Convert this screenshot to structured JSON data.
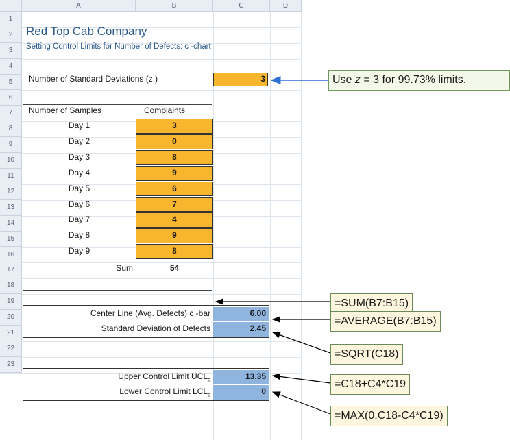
{
  "columns": [
    "A",
    "B",
    "C",
    "D"
  ],
  "rows": [
    "1",
    "2",
    "3",
    "4",
    "5",
    "6",
    "7",
    "8",
    "9",
    "10",
    "11",
    "12",
    "13",
    "14",
    "15",
    "16",
    "17",
    "18",
    "19",
    "20",
    "21",
    "22",
    "23"
  ],
  "title": "Red Top Cab Company",
  "subtitle": "Setting Control Limits for Number of Defects: c -chart",
  "std_dev_label": "Number of Standard Deviations (z )",
  "std_dev_value": "3",
  "table": {
    "header_samples": "Number of Samples",
    "header_complaints": "Complaints",
    "days": [
      "Day 1",
      "Day 2",
      "Day 3",
      "Day 4",
      "Day 5",
      "Day 6",
      "Day 7",
      "Day 8",
      "Day 9"
    ],
    "complaints": [
      "3",
      "0",
      "8",
      "9",
      "6",
      "7",
      "4",
      "9",
      "8"
    ],
    "sum_label": "Sum",
    "sum_value": "54"
  },
  "stats": {
    "center_label": "Center Line (Avg. Defects) c -bar",
    "center_value": "6.00",
    "sd_label": "Standard Deviation of Defects",
    "sd_value": "2.45",
    "ucl_label": "Upper Control Limit UCL",
    "ucl_sub": "c",
    "ucl_value": "13.35",
    "lcl_label": "Lower Control Limit LCL",
    "lcl_sub": "c",
    "lcl_value": "0"
  },
  "notes": {
    "z_note_pre": "Use ",
    "z_note_var": "z",
    "z_note_post": " = 3 for 99.73% limits.",
    "sum_formula": "=SUM(B7:B15)",
    "avg_formula": "=AVERAGE(B7:B15)",
    "sqrt_formula": "=SQRT(C18)",
    "ucl_formula": "=C18+C4*C19",
    "lcl_formula": "=MAX(0,C18-C4*C19)"
  },
  "colors": {
    "input_fill": "#f8b62f",
    "output_fill": "#8fb4de",
    "title_color": "#2a5b8c"
  }
}
